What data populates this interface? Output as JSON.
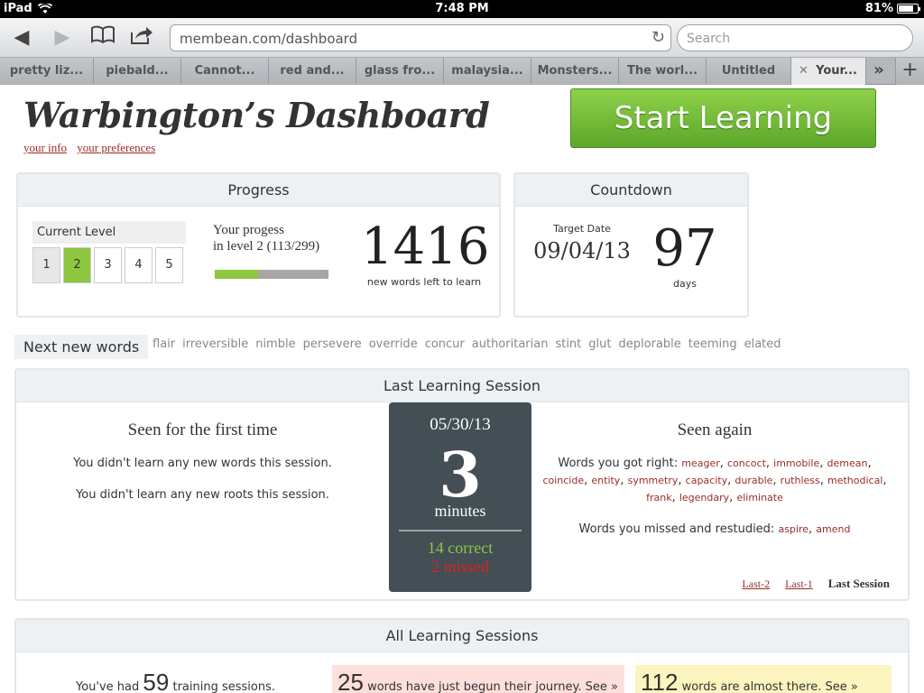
{
  "status": {
    "device": "iPad",
    "time": "7:48 PM",
    "battery": "81%",
    "battery_level": 0.81
  },
  "browser": {
    "url": "membean.com/dashboard",
    "search_placeholder": "Search",
    "tabs": [
      "pretty liz...",
      "piebald...",
      "Cannot...",
      "red and...",
      "glass fro...",
      "malaysia...",
      "Monsters...",
      "The worl...",
      "Untitled",
      "Your..."
    ],
    "active_tab": "Your..."
  },
  "header": {
    "title": "Warbington’s Dashboard",
    "links": [
      "your info",
      "your preferences"
    ],
    "start_button": "Start Learning"
  },
  "progress": {
    "title": "Progress",
    "current_level_label": "Current Level",
    "levels": [
      "1",
      "2",
      "3",
      "4",
      "5"
    ],
    "current_level": "2",
    "progress_line1": "Your progess",
    "progress_line2": "in level 2 (113/299)",
    "level_fraction": 0.378,
    "words_left": "1416",
    "words_left_label": "new words left to learn"
  },
  "countdown": {
    "title": "Countdown",
    "target_label": "Target Date",
    "target_date": "09/04/13",
    "days": "97",
    "days_label": "days"
  },
  "next_words": {
    "label": "Next new words",
    "words": [
      "flair",
      "irreversible",
      "nimble",
      "persevere",
      "override",
      "concur",
      "authoritarian",
      "stint",
      "glut",
      "deplorable",
      "teeming",
      "elated"
    ]
  },
  "last_session": {
    "title": "Last Learning Session",
    "first_time_title": "Seen for the first time",
    "no_words": "You didn't learn any new words this session.",
    "no_roots": "You didn't learn any new roots this session.",
    "date": "05/30/13",
    "minutes": "3",
    "minutes_label": "minutes",
    "correct": "14 correct",
    "missed": "2 missed",
    "seen_again_title": "Seen again",
    "right_label": "Words you got right:",
    "right_words": [
      "meager",
      "concoct",
      "immobile",
      "demean",
      "coincide",
      "entity",
      "symmetry",
      "capacity",
      "durable",
      "ruthless",
      "methodical",
      "frank",
      "legendary",
      "eliminate"
    ],
    "missed_label": "Words you missed and restudied:",
    "missed_words": [
      "aspire",
      "amend"
    ],
    "nav": [
      "Last-2",
      "Last-1"
    ],
    "nav_current": "Last Session"
  },
  "all_sessions": {
    "title": "All Learning Sessions",
    "had_prefix": "You've had",
    "sessions_count": "59",
    "had_suffix": "training sessions.",
    "begun_count": "25",
    "begun_text": "words have just begun their journey. See »",
    "almost_count": "112",
    "almost_text": "words are almost there. See »"
  },
  "colors": {
    "accent_green": "#8dc63f",
    "link_red": "#9b2a2a",
    "card_slate": "#434f55",
    "missed_red": "#e02020"
  },
  "icons": [
    "wifi-icon",
    "battery-icon",
    "back-icon",
    "forward-icon",
    "bookmarks-icon",
    "share-icon",
    "reload-icon",
    "tab-close-icon",
    "more-tabs-icon",
    "add-tab-icon"
  ]
}
